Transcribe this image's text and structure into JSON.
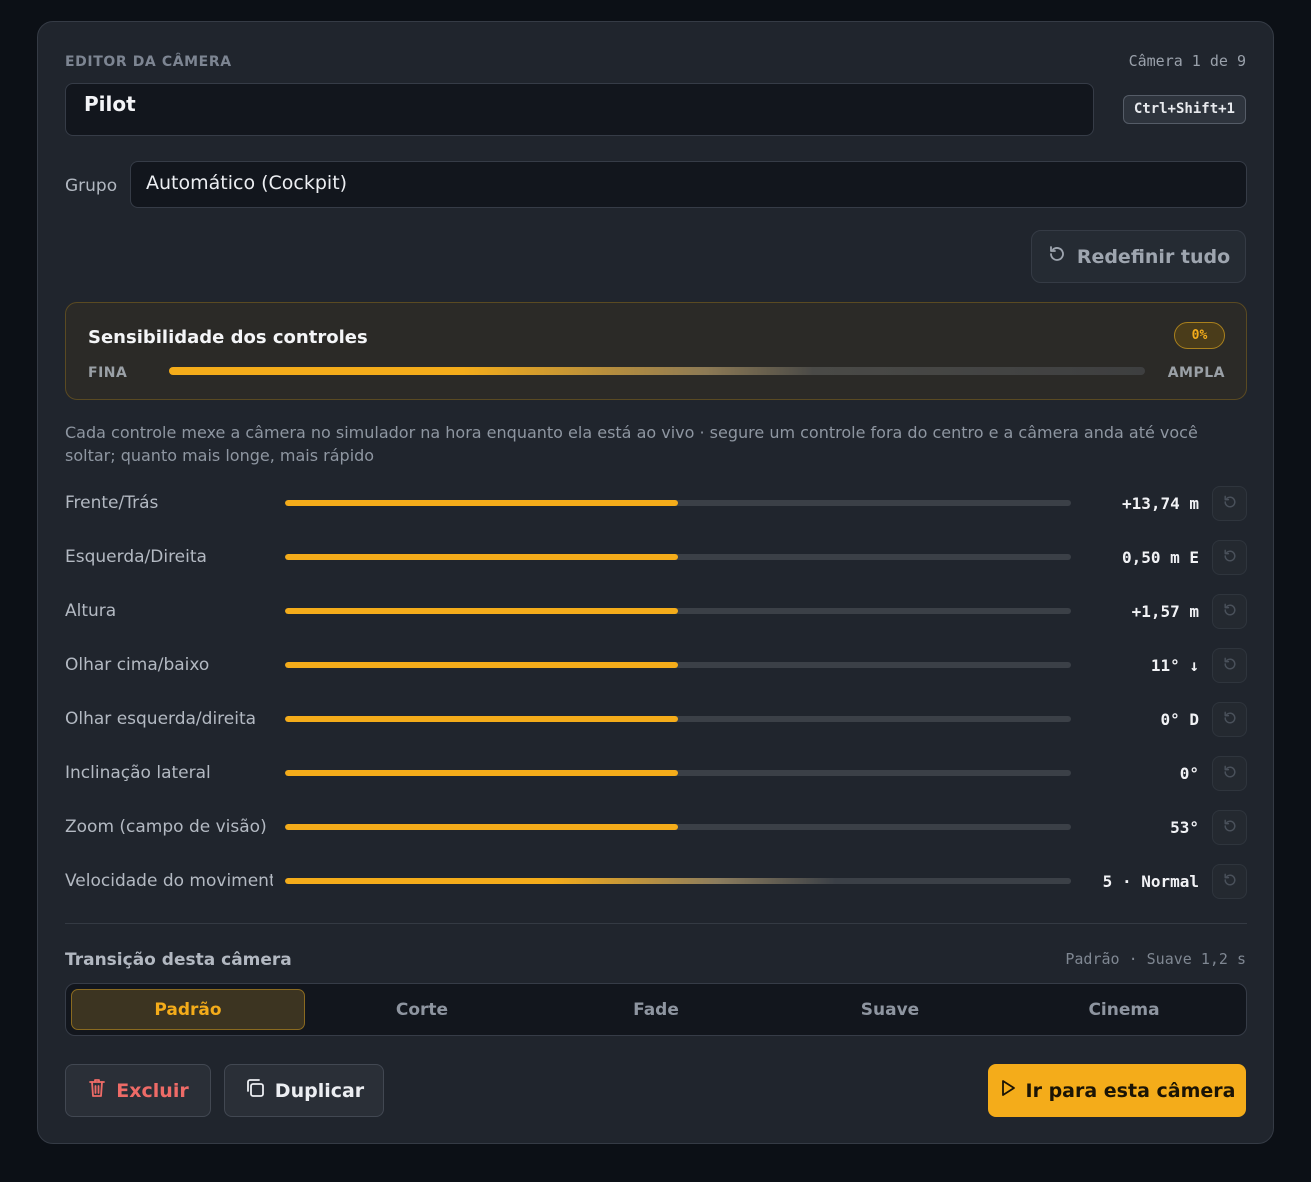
{
  "header": {
    "eyebrow": "EDITOR DA CÂMERA",
    "counter": "Câmera 1 de 9",
    "camera_name": "Pilot",
    "shortcut": "Ctrl+Shift+1"
  },
  "group": {
    "label": "Grupo",
    "value": "Automático (Cockpit)"
  },
  "reset_all": {
    "label": "Redefinir tudo",
    "icon": "reset-icon"
  },
  "sensitivity": {
    "title": "Sensibilidade dos controles",
    "badge": "0%",
    "min_label": "FINA",
    "max_label": "AMPLA"
  },
  "help_text": "Cada controle mexe a câmera no simulador na hora enquanto ela está ao vivo · segure um controle fora do centro e a câmera anda até você soltar; quanto mais longe, mais rápido",
  "controls": [
    {
      "label": "Frente/Trás",
      "value": "+13,74 m",
      "level": 0.5
    },
    {
      "label": "Esquerda/Direita",
      "value": "0,50 m E",
      "level": 0.5
    },
    {
      "label": "Altura",
      "value": "+1,57 m",
      "level": 0.5
    },
    {
      "label": "Olhar cima/baixo",
      "value": "11° ↓",
      "level": 0.5
    },
    {
      "label": "Olhar esquerda/direita",
      "value": "0° D",
      "level": 0.5
    },
    {
      "label": "Inclinação lateral",
      "value": "0°",
      "level": 0.5
    },
    {
      "label": "Zoom (campo de visão)",
      "value": "53°",
      "level": 0.5
    },
    {
      "label": "Velocidade do movimento",
      "value": "5 · Normal",
      "level": 0.5
    }
  ],
  "transition": {
    "title": "Transição desta câmera",
    "summary": "Padrão · Suave 1,2 s",
    "options": [
      "Padrão",
      "Corte",
      "Fade",
      "Suave",
      "Cinema"
    ],
    "selected": "Padrão"
  },
  "actions": {
    "delete": "Excluir",
    "duplicate": "Duplicar",
    "go": "Ir para esta câmera"
  },
  "colors": {
    "accent": "#f4ac1a",
    "danger": "#ee6b67",
    "panel": "#20252d",
    "background": "#0c1016"
  }
}
